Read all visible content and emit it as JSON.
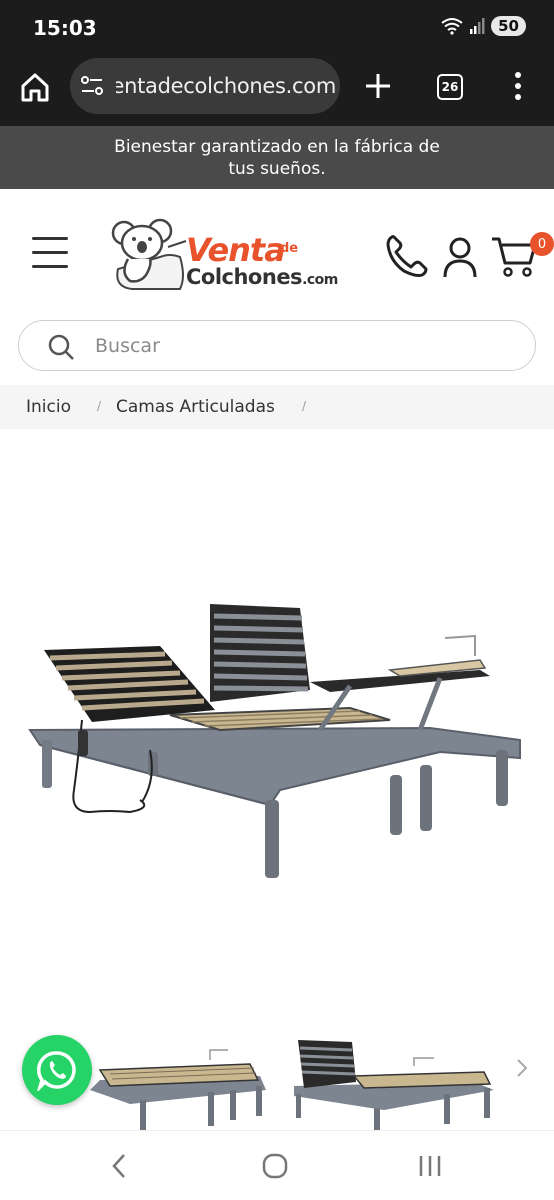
{
  "status_bar": {
    "time": "15:03",
    "battery": "50"
  },
  "browser": {
    "url": "ventadecolchones.com",
    "tab_count": "26"
  },
  "announcement": {
    "line1": "Bienestar garantizado en la fábrica de",
    "line2": "tus sueños."
  },
  "logo": {
    "venta": "Venta",
    "de": "de",
    "colchones": "Colchones",
    "dotcom": ".com"
  },
  "cart": {
    "count": "0"
  },
  "search": {
    "placeholder": "Buscar"
  },
  "breadcrumb": {
    "home": "Inicio",
    "separator": "/",
    "category": "Camas Articuladas"
  },
  "colors": {
    "brand_orange": "#e8532c",
    "whatsapp_green": "#25d366",
    "topbar": "#1c1c1c",
    "announce_bg": "#4a4a4a"
  }
}
